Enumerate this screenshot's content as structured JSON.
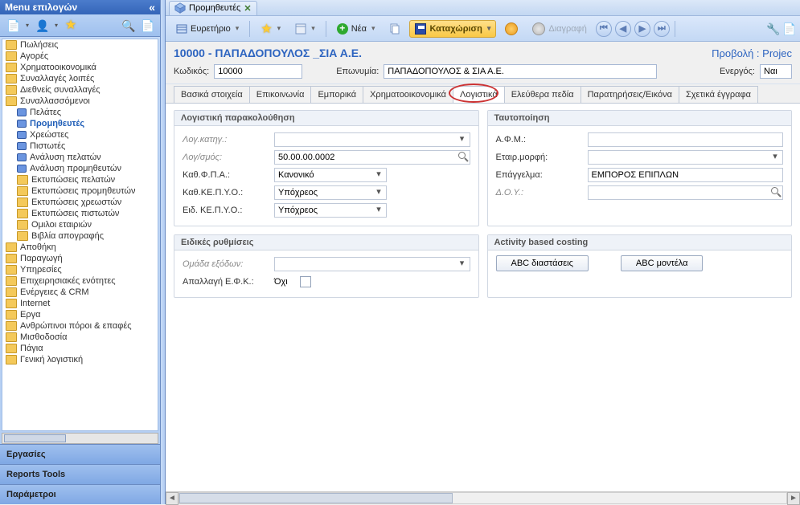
{
  "sidebar": {
    "title": "Menu επιλογών",
    "nodes": [
      {
        "label": "Πωλήσεις",
        "lvl": 0,
        "icon": "folder"
      },
      {
        "label": "Αγορές",
        "lvl": 0,
        "icon": "folder"
      },
      {
        "label": "Χρηματοοικονομικά",
        "lvl": 0,
        "icon": "folder"
      },
      {
        "label": "Συναλλαγές λοιπές",
        "lvl": 0,
        "icon": "folder"
      },
      {
        "label": "Διεθνείς συναλλαγές",
        "lvl": 0,
        "icon": "folder"
      },
      {
        "label": "Συναλλασσόμενοι",
        "lvl": 0,
        "icon": "folder"
      },
      {
        "label": "Πελάτες",
        "lvl": 1,
        "icon": "box"
      },
      {
        "label": "Προμηθευτές",
        "lvl": 1,
        "icon": "box",
        "selected": true
      },
      {
        "label": "Χρεώστες",
        "lvl": 1,
        "icon": "box"
      },
      {
        "label": "Πιστωτές",
        "lvl": 1,
        "icon": "box"
      },
      {
        "label": "Ανάλυση πελατών",
        "lvl": 1,
        "icon": "box"
      },
      {
        "label": "Ανάλυση προμηθευτών",
        "lvl": 1,
        "icon": "box"
      },
      {
        "label": "Εκτυπώσεις πελατών",
        "lvl": 1,
        "icon": "folder"
      },
      {
        "label": "Εκτυπώσεις προμηθευτών",
        "lvl": 1,
        "icon": "folder"
      },
      {
        "label": "Εκτυπώσεις χρεωστών",
        "lvl": 1,
        "icon": "folder"
      },
      {
        "label": "Εκτυπώσεις πιστωτών",
        "lvl": 1,
        "icon": "folder"
      },
      {
        "label": "Ομιλοι εταιριών",
        "lvl": 1,
        "icon": "folder"
      },
      {
        "label": "Βιβλία απογραφής",
        "lvl": 1,
        "icon": "folder"
      },
      {
        "label": "Αποθήκη",
        "lvl": 0,
        "icon": "folder"
      },
      {
        "label": "Παραγωγή",
        "lvl": 0,
        "icon": "folder"
      },
      {
        "label": "Υπηρεσίες",
        "lvl": 0,
        "icon": "folder"
      },
      {
        "label": "Επιχειρησιακές ενότητες",
        "lvl": 0,
        "icon": "folder"
      },
      {
        "label": "Ενέργειες & CRM",
        "lvl": 0,
        "icon": "folder"
      },
      {
        "label": "Internet",
        "lvl": 0,
        "icon": "folder"
      },
      {
        "label": "Εργα",
        "lvl": 0,
        "icon": "folder"
      },
      {
        "label": "Ανθρώπινοι πόροι & επαφές",
        "lvl": 0,
        "icon": "folder"
      },
      {
        "label": "Μισθοδοσία",
        "lvl": 0,
        "icon": "folder"
      },
      {
        "label": "Πάγια",
        "lvl": 0,
        "icon": "folder"
      },
      {
        "label": "Γενική λογιστική",
        "lvl": 0,
        "icon": "folder"
      }
    ],
    "panels": [
      "Εργασίες",
      "Reports Tools",
      "Παράμετροι"
    ]
  },
  "document": {
    "tab_title": "Προμηθευτές",
    "close": "✕",
    "toolbar": {
      "index_label": "Ευρετήριο",
      "new_label": "Νέα",
      "save_label": "Καταχώριση",
      "delete_label": "Διαγραφή"
    },
    "header": {
      "title": "10000 - ΠΑΠΑΔΟΠΟΥΛΟΣ _ΣΙΑ Α.Ε.",
      "projection": "Προβολή : Projec"
    },
    "row": {
      "code_label": "Κωδικός:",
      "code_value": "10000",
      "name_label": "Επωνυμία:",
      "name_value": "ΠΑΠΑΔΟΠΟΥΛΟΣ & ΣΙΑ Α.Ε.",
      "active_label": "Ενεργός:",
      "active_value": "Ναι"
    },
    "tabs": [
      "Βασικά στοιχεία",
      "Επικοινωνία",
      "Εμπορικά",
      "Χρηματοοικονομικά",
      "Λογιστικά",
      "Ελεύθερα πεδία",
      "Παρατηρήσεις/Εικόνα",
      "Σχετικά έγγραφα"
    ],
    "active_tab": 4,
    "section1": {
      "title": "Λογιστική παρακολούθηση",
      "f1_label": "Λογ.κατηγ.:",
      "f1_value": "",
      "f2_label": "Λογ/σμός:",
      "f2_value": "50.00.00.0002",
      "f3_label": "Καθ.Φ.Π.Α.:",
      "f3_value": "Κανονικό",
      "f4_label": "Καθ.ΚΕ.Π.Υ.Ο.:",
      "f4_value": "Υπόχρεος",
      "f5_label": "Ειδ. ΚΕ.Π.Υ.Ο.:",
      "f5_value": "Υπόχρεος"
    },
    "section2": {
      "title": "Ταυτοποίηση",
      "f1_label": "Α.Φ.Μ.:",
      "f1_value": "",
      "f2_label": "Εταιρ.μορφή:",
      "f2_value": "",
      "f3_label": "Επάγγελμα:",
      "f3_value": "ΕΜΠΟΡΟΣ ΕΠΙΠΛΩΝ",
      "f4_label": "Δ.Ο.Υ.:",
      "f4_value": ""
    },
    "section3": {
      "title": "Ειδικές ρυθμίσεις",
      "f1_label": "Ομάδα εξόδων:",
      "f1_value": "",
      "f2_label": "Απαλλαγή Ε.Φ.Κ.:",
      "f2_value": "Όχι"
    },
    "section4": {
      "title": "Activity based costing",
      "btn1": "ABC διαστάσεις",
      "btn2": "ABC μοντέλα"
    }
  }
}
